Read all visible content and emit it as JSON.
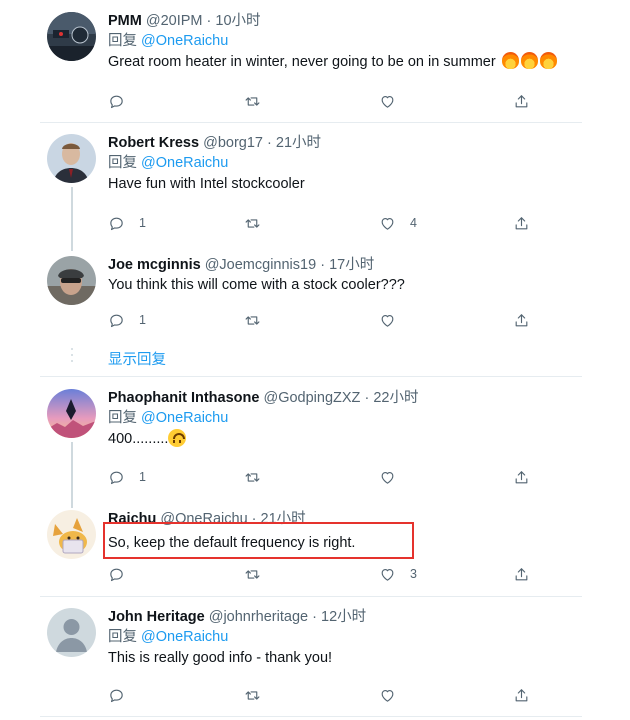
{
  "tweets": [
    {
      "name": "PMM",
      "handle": "@20IPM",
      "time": "10小时",
      "reply_prefix": "回复",
      "reply_to": "@OneRaichu",
      "text": "Great room heater in winter, never going to be on in summer",
      "emoji": "fire x3",
      "reply_count": "",
      "retweet_count": "",
      "like_count": ""
    },
    {
      "name": "Robert Kress",
      "handle": "@borg17",
      "time": "21小时",
      "reply_prefix": "回复",
      "reply_to": "@OneRaichu",
      "text": "Have fun with Intel stockcooler",
      "reply_count": "1",
      "retweet_count": "",
      "like_count": "4"
    },
    {
      "name": "Joe mcginnis",
      "handle": "@Joemcginnis19",
      "time": "17小时",
      "text": "You think this will come with a stock cooler???",
      "reply_count": "1",
      "retweet_count": "",
      "like_count": ""
    },
    {
      "name": "Phaophanit Inthasone",
      "handle": "@GodpingZXZ",
      "time": "22小时",
      "reply_prefix": "回复",
      "reply_to": "@OneRaichu",
      "text": "400.........",
      "emoji": "upside-down-face",
      "reply_count": "1",
      "retweet_count": "",
      "like_count": ""
    },
    {
      "name": "Raichu",
      "handle": "@OneRaichu",
      "time": "21小时",
      "text": "So, keep the default frequency is right.",
      "reply_count": "",
      "retweet_count": "",
      "like_count": "3"
    },
    {
      "name": "John Heritage",
      "handle": "@johnrheritage",
      "time": "12小时",
      "reply_prefix": "回复",
      "reply_to": "@OneRaichu",
      "text": "This is really good info - thank you!",
      "reply_count": "",
      "retweet_count": "",
      "like_count": ""
    }
  ],
  "show_replies_label": "显示回复",
  "separator": "·",
  "colors": {
    "accent": "#1d9bf0",
    "muted": "#536471",
    "divider": "#e6ecf0",
    "highlight": "#e5322d"
  },
  "icons": [
    "reply-icon",
    "retweet-icon",
    "like-icon",
    "share-icon"
  ]
}
